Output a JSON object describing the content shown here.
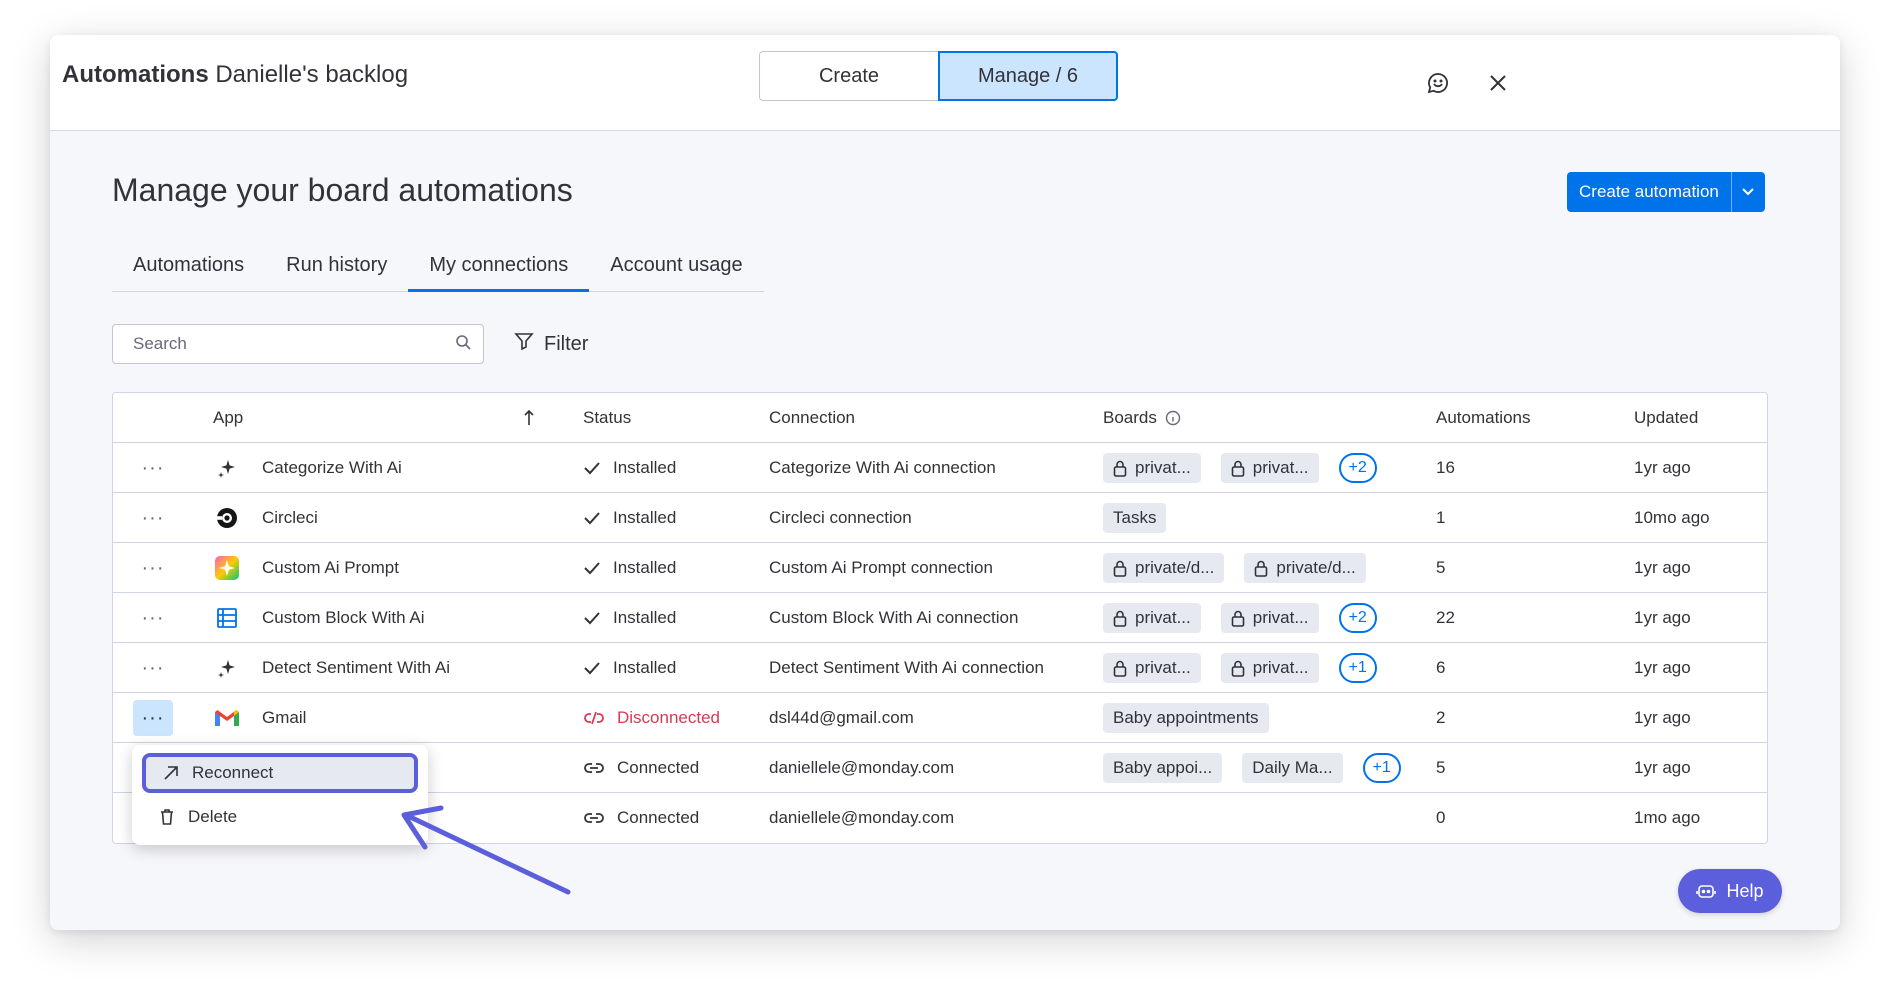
{
  "header": {
    "app_name": "Automations",
    "board_name": "Danielle's backlog",
    "seg_create": "Create",
    "seg_manage": "Manage / 6"
  },
  "page": {
    "title": "Manage your board automations",
    "create_button": "Create automation"
  },
  "tabs": [
    {
      "label": "Automations"
    },
    {
      "label": "Run history"
    },
    {
      "label": "My connections",
      "active": true
    },
    {
      "label": "Account usage"
    }
  ],
  "search": {
    "placeholder": "Search",
    "value": ""
  },
  "filter_label": "Filter",
  "table": {
    "columns": {
      "app": "App",
      "status": "Status",
      "connection": "Connection",
      "boards": "Boards",
      "automations": "Automations",
      "updated": "Updated"
    },
    "rows": [
      {
        "icon": "sparkle-icon",
        "app": "Categorize With Ai",
        "status": "Installed",
        "connection": "Categorize With Ai connection",
        "boards": [
          "privat...",
          "privat..."
        ],
        "more": "+2",
        "automations": "16",
        "updated": "1yr ago"
      },
      {
        "icon": "circleci-icon",
        "app": "Circleci",
        "status": "Installed",
        "connection": "Circleci connection",
        "boards": [
          "Tasks"
        ],
        "more": "",
        "automations": "1",
        "updated": "10mo ago"
      },
      {
        "icon": "ai-prompt-icon",
        "app": "Custom Ai Prompt",
        "status": "Installed",
        "connection": "Custom Ai Prompt connection",
        "boards": [
          "private/d...",
          "private/d..."
        ],
        "more": "",
        "automations": "5",
        "updated": "1yr ago"
      },
      {
        "icon": "block-icon",
        "app": "Custom Block With Ai",
        "status": "Installed",
        "connection": "Custom Block With Ai connection",
        "boards": [
          "privat...",
          "privat..."
        ],
        "more": "+2",
        "automations": "22",
        "updated": "1yr ago"
      },
      {
        "icon": "sparkle-icon",
        "app": "Detect Sentiment With Ai",
        "status": "Installed",
        "connection": "Detect Sentiment With Ai connection",
        "boards": [
          "privat...",
          "privat..."
        ],
        "more": "+1",
        "automations": "6",
        "updated": "1yr ago"
      },
      {
        "icon": "gmail-icon",
        "app": "Gmail",
        "status": "Disconnected",
        "connection": "dsl44d@gmail.com",
        "boards": [
          "Baby appointments"
        ],
        "more": "",
        "automations": "2",
        "updated": "1yr ago"
      },
      {
        "icon": "",
        "app": "",
        "status": "Connected",
        "connection": "daniellele@monday.com",
        "boards": [
          "Baby appoi...",
          "Daily Ma..."
        ],
        "more": "+1",
        "automations": "5",
        "updated": "1yr ago"
      },
      {
        "icon": "",
        "app": "",
        "status": "Connected",
        "connection": "daniellele@monday.com",
        "boards": [],
        "more": "",
        "automations": "0",
        "updated": "1mo ago"
      }
    ]
  },
  "menu": {
    "reconnect": "Reconnect",
    "delete": "Delete"
  },
  "help_label": "Help",
  "colors": {
    "accent": "#0073ea",
    "highlight": "#5b5fdc",
    "danger": "#d83a52"
  }
}
